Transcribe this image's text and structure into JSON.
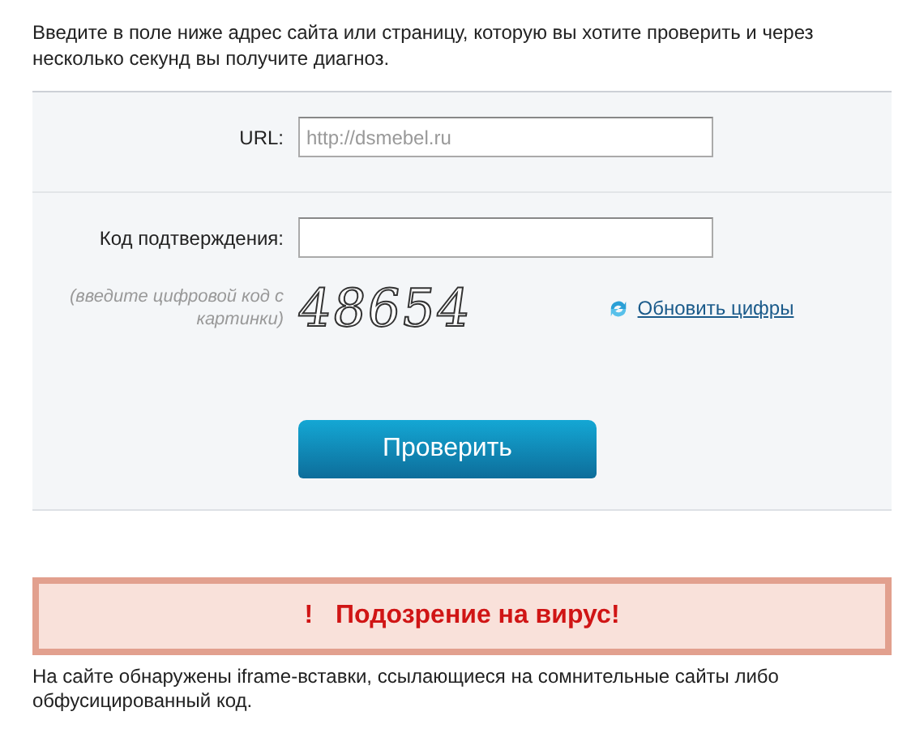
{
  "intro": "Введите в поле ниже адрес сайта или страницу, которую вы хотите проверить и через несколько секунд вы получите диагноз.",
  "form": {
    "url_label": "URL:",
    "url_placeholder": "http://dsmebel.ru",
    "code_label": "Код подтверждения:",
    "code_hint": "(введите цифровой код с картинки)",
    "captcha": "48654",
    "refresh_link": "Обновить цифры",
    "submit": "Проверить"
  },
  "alert": {
    "icon": "!",
    "message": "Подозрение на вирус!"
  },
  "result_text": "На сайте обнаружены iframe-вставки, ссылающиеся на сомнительные сайты либо обфусицированный код."
}
